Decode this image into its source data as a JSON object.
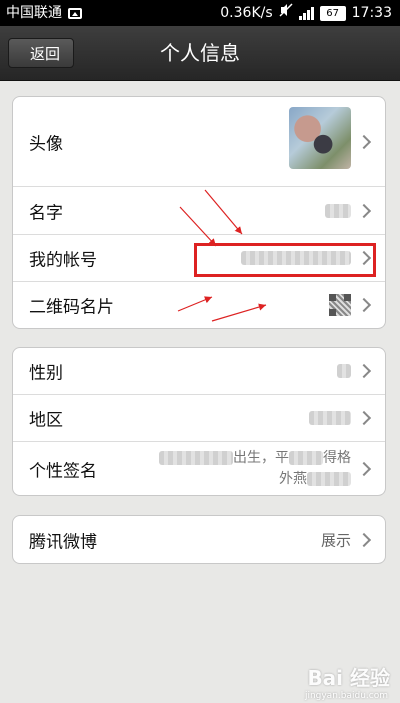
{
  "status_bar": {
    "carrier": "中国联通",
    "speed": "0.36K/s",
    "battery": "67",
    "time": "17:33"
  },
  "header": {
    "back_label": "返回",
    "title": "个人信息"
  },
  "groups": [
    {
      "rows": [
        {
          "label": "头像"
        },
        {
          "label": "名字"
        },
        {
          "label": "我的帐号"
        },
        {
          "label": "二维码名片"
        }
      ]
    },
    {
      "rows": [
        {
          "label": "性别"
        },
        {
          "label": "地区"
        },
        {
          "label": "个性签名",
          "value_line1": "出生，平",
          "value_line1b": "得格",
          "value_line2": "外燕"
        }
      ]
    },
    {
      "rows": [
        {
          "label": "腾讯微博",
          "value": "展示"
        }
      ]
    }
  ],
  "annotation": {
    "highlight_color": "#dd2222"
  },
  "watermark": {
    "text": "Bai 经验",
    "sub": "jingyan.baidu.com"
  }
}
